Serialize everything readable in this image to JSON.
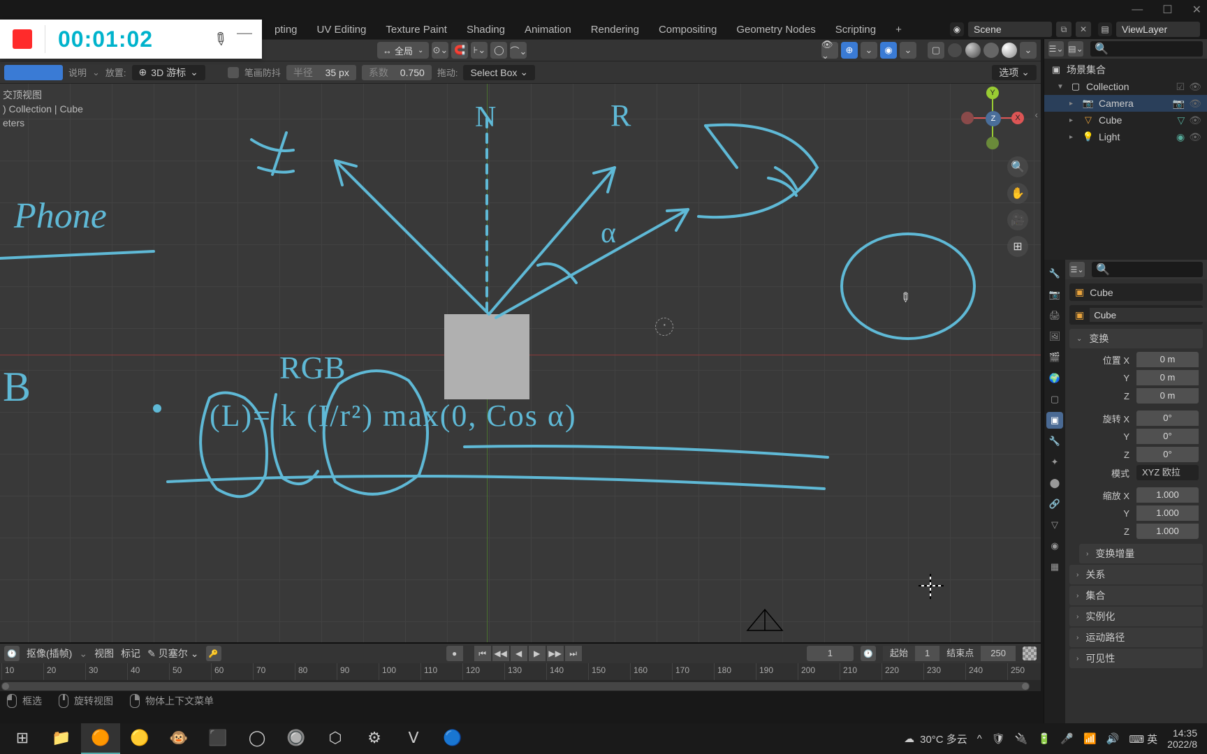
{
  "recorder": {
    "time": "00:01:02"
  },
  "titlebar": {
    "minimize": "—",
    "maximize": "☐",
    "close": "✕"
  },
  "topmenu": {
    "items": [
      "pting",
      "UV Editing",
      "Texture Paint",
      "Shading",
      "Animation",
      "Rendering",
      "Compositing",
      "Geometry Nodes",
      "Scripting"
    ],
    "plus": "+",
    "scene_value": "Scene",
    "viewlayer_value": "ViewLayer"
  },
  "header": {
    "transform": "全局",
    "overlay_label": "",
    "shading_hint": ""
  },
  "sub": {
    "annot_label": "说明",
    "place_label": "放置:",
    "cursor3d": "3D 游标",
    "stroke_label": "笔画防抖",
    "radius_label": "半径",
    "radius_value": "35 px",
    "factor_label": "系数",
    "factor_value": "0.750",
    "drag_label": "拖动:",
    "select_box": "Select Box",
    "options": "选项"
  },
  "viewport": {
    "line1": "交顶视图",
    "line2": ") Collection | Cube",
    "line3": "eters",
    "gizmo_z": "Z",
    "gizmo_y": "Y",
    "gizmo_x": "X"
  },
  "annotations": {
    "n": "N",
    "r": "R",
    "phone": "Phone",
    "b": "B",
    "rgb": "RGB",
    "alpha": "α",
    "formula": "(L)= k (I/r²)  max(0, Cos α)"
  },
  "outliner": {
    "root": "场景集合",
    "collection": "Collection",
    "camera": "Camera",
    "cube": "Cube",
    "light": "Light"
  },
  "props": {
    "obj_name": "Cube",
    "data_name": "Cube",
    "transform_hdr": "变换",
    "pos_label": "位置 X",
    "pos_y": "Y",
    "pos_z": "Z",
    "pos_vx": "0 m",
    "pos_vy": "0 m",
    "pos_vz": "0 m",
    "rot_label": "旋转 X",
    "rot_vx": "0°",
    "rot_vy": "0°",
    "rot_vz": "0°",
    "mode_label": "模式",
    "mode_value": "XYZ 欧拉",
    "scale_label": "缩放 X",
    "scale_vx": "1.000",
    "scale_vy": "1.000",
    "scale_vz": "1.000",
    "delta_hdr": "变换增量",
    "rel_hdr": "关系",
    "coll_hdr": "集合",
    "inst_hdr": "实例化",
    "motion_hdr": "运动路径",
    "vis_hdr": "可见性"
  },
  "timeline": {
    "view": "视图",
    "mark": "标记",
    "key_icon": "抠像(插帧)",
    "bezier": "贝塞尔",
    "frame_current": "1",
    "start_label": "起始",
    "start_val": "1",
    "end_label": "结束点",
    "end_val": "250",
    "ticks": [
      "10",
      "20",
      "30",
      "40",
      "50",
      "60",
      "70",
      "80",
      "90",
      "100",
      "110",
      "120",
      "130",
      "140",
      "150",
      "160",
      "170",
      "180",
      "190",
      "200",
      "210",
      "220",
      "230",
      "240",
      "250"
    ]
  },
  "status": {
    "box_select": "框选",
    "rotate_view": "旋转视图",
    "context_menu": "物体上下文菜单"
  },
  "taskbar": {
    "weather_temp": "30°C 多云",
    "ime": "英",
    "time": "14:35",
    "date": "2022/8"
  }
}
